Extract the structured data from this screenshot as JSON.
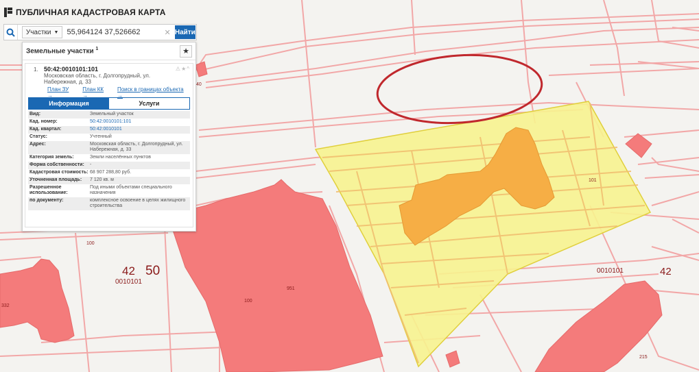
{
  "header": {
    "title": "ПУБЛИЧНАЯ КАДАСТРОВАЯ КАРТА",
    "logo_icon": "pkk-logo-icon"
  },
  "search": {
    "icon": "search-icon",
    "type_label": "Участки",
    "query": "55,964124 37,526662",
    "clear_icon": "close-icon",
    "find_label": "Найти"
  },
  "panel": {
    "title": "Земельные участки",
    "count": "1",
    "star_icon": "star-icon",
    "result": {
      "index": "1.",
      "cad_id": "50:42:0010101:101",
      "address": "Московская область, г. Долгопрудный, ул. Набережная, д. 33",
      "links": [
        "План ЗУ →",
        "План КК →",
        "Поиск в границах объекта →"
      ],
      "tabs": {
        "info": "Информация",
        "services": "Услуги"
      },
      "props": [
        {
          "label": "Вид:",
          "value": "Земельный участок",
          "link": false
        },
        {
          "label": "Кад. номер:",
          "value": "50:42:0010101:101",
          "link": true
        },
        {
          "label": "Кад. квартал:",
          "value": "50:42:0010101",
          "link": true
        },
        {
          "label": "Статус:",
          "value": "Учтенный",
          "link": false
        },
        {
          "label": "Адрес:",
          "value": "Московская область, г. Долгопрудный, ул. Набережная, д. 33",
          "link": false
        },
        {
          "label": "Категория земель:",
          "value": "Земли населённых пунктов",
          "link": false
        },
        {
          "label": "Форма собственности:",
          "value": "-",
          "link": false
        },
        {
          "label": "Кадастровая стоимость:",
          "value": "68 907 288,80 руб.",
          "link": false
        },
        {
          "label": "Уточненная площадь:",
          "value": "7 120 кв. м",
          "link": false
        },
        {
          "label": "Разрешенное использование:",
          "value": "Под иными объектами специального назначения",
          "link": false
        },
        {
          "label": "по документу:",
          "value": "комплексное освоение в целях жилищного строительства",
          "link": false
        }
      ]
    }
  },
  "map": {
    "colors": {
      "background": "#f4f3f0",
      "parcel_lines": "#f2a7a7",
      "building_fill": "#f47b7b",
      "selected_fill": "#f7f38f",
      "selected_building": "#f6ae45",
      "highlight_ellipse": "#c0282d"
    },
    "labels": {
      "q_42_left": "42",
      "q_50": "50",
      "q_code_left": "0010101",
      "q_code_right": "0010101",
      "q_42_right": "42",
      "p_100_a": "100",
      "p_100_b": "100",
      "p_101": "101",
      "p_215": "215",
      "p_40": "40",
      "p_332": "332",
      "p_951": "951"
    }
  }
}
